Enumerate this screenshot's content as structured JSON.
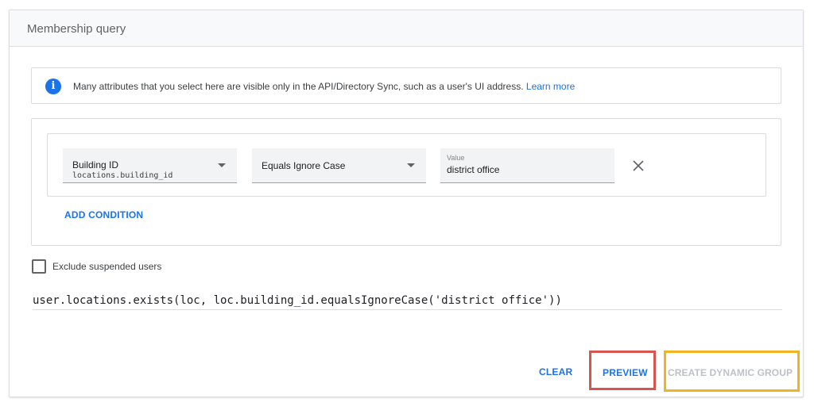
{
  "card": {
    "title": "Membership query"
  },
  "info": {
    "text": "Many attributes that you select here are visible only in the API/Directory Sync, such as a user's UI address.",
    "link": "Learn more"
  },
  "condition": {
    "attribute": {
      "label": "Building ID",
      "path": "locations.building_id"
    },
    "operator": "Equals Ignore Case",
    "value_label": "Value",
    "value": "district office"
  },
  "add_condition_label": "ADD CONDITION",
  "exclude_suspended": {
    "label": "Exclude suspended users",
    "checked": false
  },
  "query": "user.locations.exists(loc, loc.building_id.equalsIgnoreCase('district office'))",
  "actions": {
    "clear": "CLEAR",
    "preview": "PREVIEW",
    "create": "CREATE DYNAMIC GROUP"
  },
  "colors": {
    "accent": "#1a73e8",
    "preview_highlight": "#d9534f",
    "create_highlight": "#f0b323",
    "disabled_text": "#bdc1c6"
  },
  "icons": {
    "info": "info-icon",
    "remove": "close-icon",
    "dropdown": "caret-down-icon"
  }
}
